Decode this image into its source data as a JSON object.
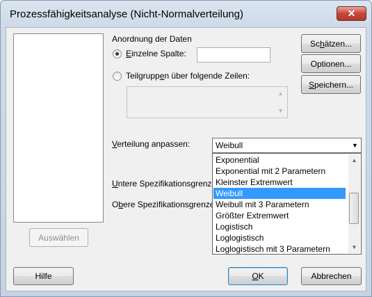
{
  "window": {
    "title": "Prozessfähigkeitsanalyse (Nicht-Normalverteilung)",
    "close_glyph": "✕"
  },
  "variables_list": {
    "select_button": "Auswählen"
  },
  "data_arrangement": {
    "heading": "Anordnung der Daten",
    "single_column": {
      "label": "Einzelne Spalte:",
      "selected": true,
      "value": ""
    },
    "subgroups": {
      "label": "Teilgruppen über folgende Zeilen:",
      "selected": false,
      "value": ""
    }
  },
  "side_buttons": {
    "estimate": "Schätzen...",
    "options": "Optionen...",
    "storage": "Speichern..."
  },
  "distribution": {
    "label": "Verteilung anpassen:",
    "selected": "Weibull",
    "options": [
      "Exponential",
      "Exponential mit 2 Parametern",
      "Kleinster Extremwert",
      "Weibull",
      "Weibull mit 3 Parametern",
      "Größter Extremwert",
      "Logistisch",
      "Loglogistisch",
      "Loglogistisch mit 3 Parametern"
    ],
    "highlighted_index": 3
  },
  "spec_limits": {
    "lower_label": "Untere Spezifikationsgrenze:",
    "upper_label": "Obere Spezifikationsgrenze:"
  },
  "footer": {
    "help": "Hilfe",
    "ok": "OK",
    "cancel": "Abbrechen"
  },
  "icons": {
    "scroll_up": "▲",
    "scroll_down": "▼",
    "combo_arrow": "▼"
  }
}
